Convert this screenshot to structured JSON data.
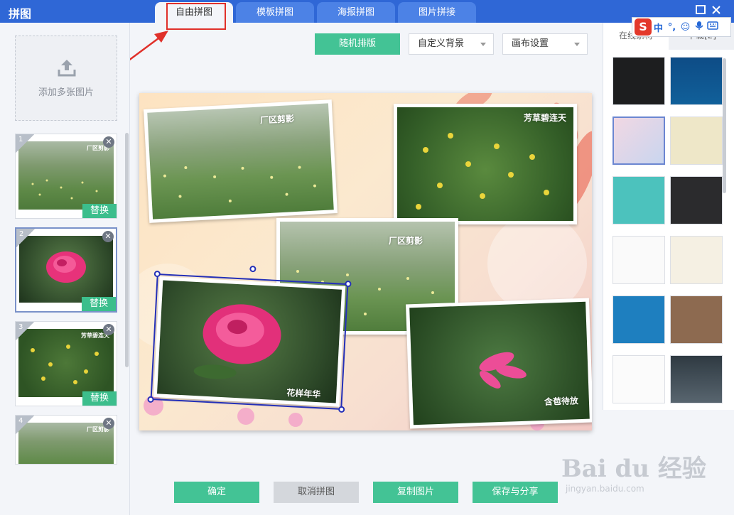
{
  "app": {
    "title": "拼图"
  },
  "tabs": [
    {
      "label": "自由拼图",
      "active": true
    },
    {
      "label": "模板拼图",
      "active": false
    },
    {
      "label": "海报拼图",
      "active": false
    },
    {
      "label": "图片拼接",
      "active": false
    }
  ],
  "window": {
    "minimize_icon": "minimize-icon",
    "close_icon": "close-icon"
  },
  "left": {
    "add_label": "添加多张图片",
    "thumbs": [
      {
        "num": "1",
        "caption": "厂区剪影",
        "replace": "替换"
      },
      {
        "num": "2",
        "caption": "",
        "replace": "替换"
      },
      {
        "num": "3",
        "caption": "芳草碧连天",
        "replace": "替换"
      },
      {
        "num": "4",
        "caption": "厂区剪影",
        "replace": ""
      }
    ]
  },
  "toolbar": {
    "random_label": "随机排版",
    "bg_label": "自定义背景",
    "canvas_label": "画布设置"
  },
  "canvas": {
    "captions": [
      "厂区剪影",
      "芳草碧连天",
      "厂区剪影",
      "花样年华",
      "含苞待放"
    ]
  },
  "right": {
    "tab_online": "在线素材",
    "tab_download": "下载[2]"
  },
  "ime": {
    "logo": "S",
    "lang": "中",
    "punct": "°,",
    "face": "☺"
  },
  "bottom": {
    "confirm": "确定",
    "cancel": "取消拼图",
    "copy": "复制图片",
    "save": "保存与分享"
  },
  "watermark": {
    "main": "Bai du 经验",
    "sub": "jingyan.baidu.com"
  },
  "colors": {
    "titlebar": "#2f67d6",
    "accent_green": "#43c395",
    "highlight_red": "#e0302a",
    "selection_blue": "#2430b8"
  }
}
